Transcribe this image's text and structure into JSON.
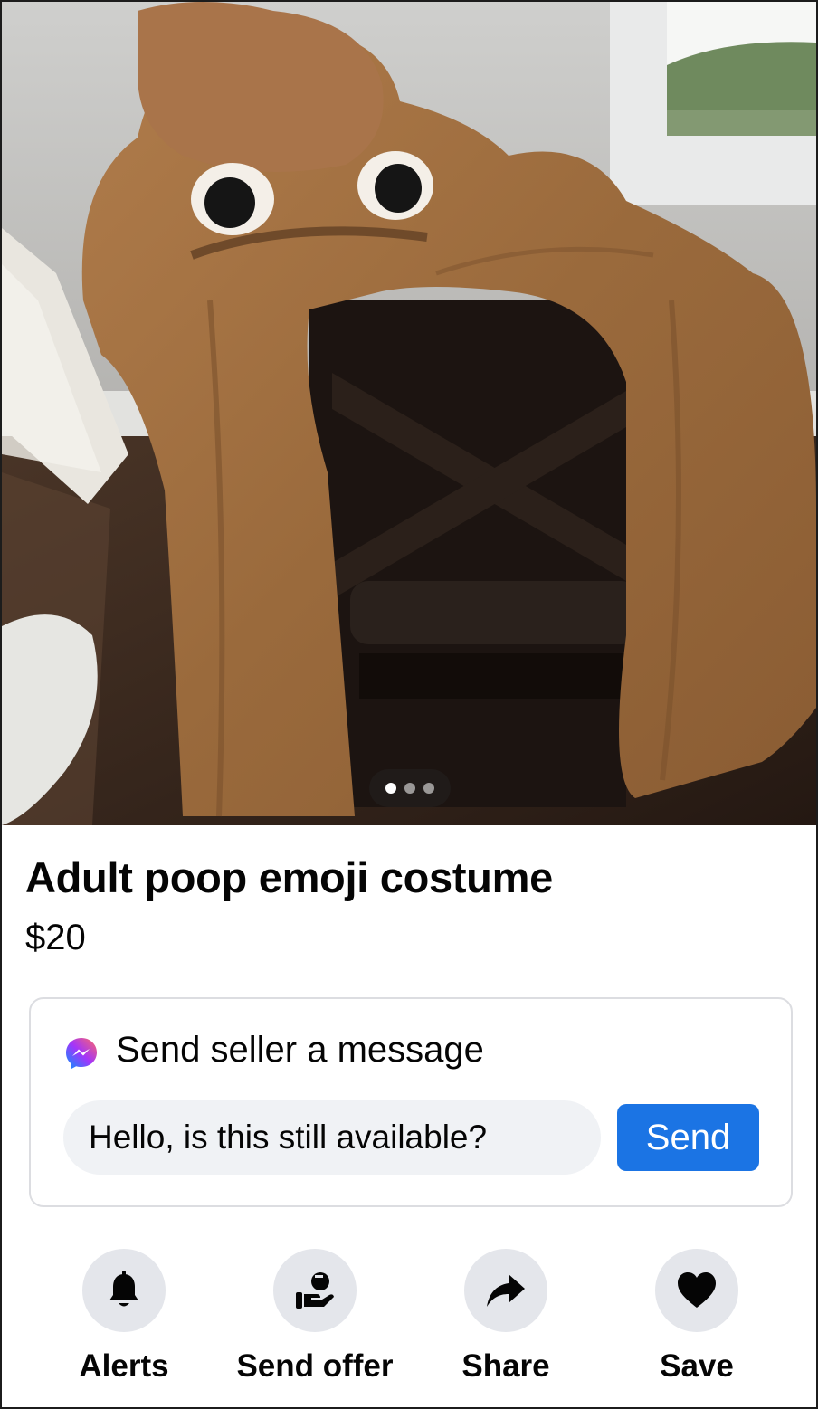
{
  "listing": {
    "title": "Adult poop emoji costume",
    "price": "$20",
    "photo": {
      "description_icon": "photo-of-costume",
      "carousel_count": 3,
      "carousel_active_index": 0
    }
  },
  "message_card": {
    "icon": "messenger-icon",
    "heading": "Send seller a message",
    "input_value": "Hello, is this still available?",
    "send_label": "Send"
  },
  "actions": [
    {
      "label": "Alerts",
      "icon": "bell-icon"
    },
    {
      "label": "Send offer",
      "icon": "offer-icon"
    },
    {
      "label": "Share",
      "icon": "share-icon"
    },
    {
      "label": "Save",
      "icon": "heart-icon"
    }
  ],
  "colors": {
    "accent": "#1b74e4",
    "icon_bg": "#e4e6eb",
    "input_bg": "#f0f2f5",
    "costume": "#a2703f"
  }
}
